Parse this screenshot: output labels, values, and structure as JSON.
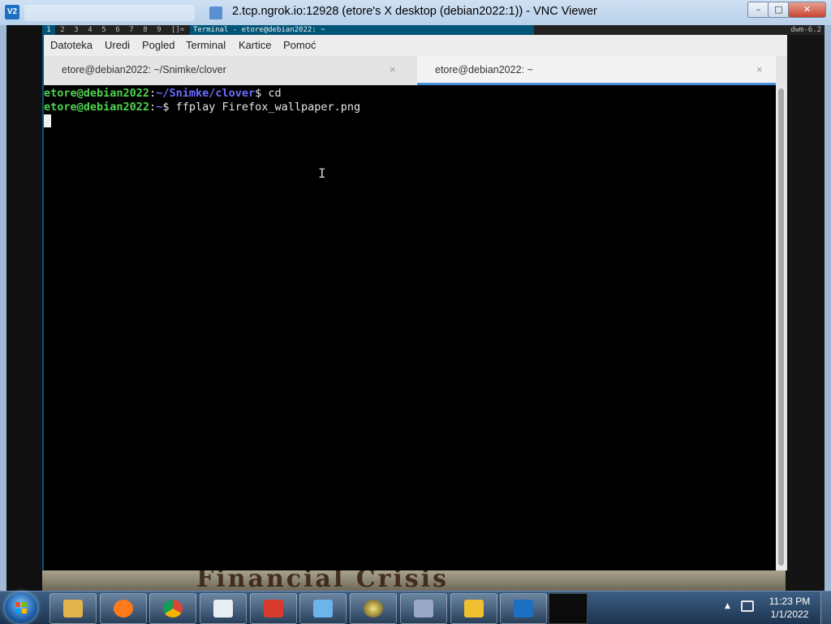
{
  "vnc_window": {
    "title": "2.tcp.ngrok.io:12928 (etore's X desktop (debian2022:1)) - VNC Viewer",
    "app_icon_text": "V2",
    "controls": {
      "minimize": "–",
      "maximize": "□",
      "close": "✕"
    }
  },
  "dwm": {
    "tags": [
      "1",
      "2",
      "3",
      "4",
      "5",
      "6",
      "7",
      "8",
      "9"
    ],
    "active_tag": "1",
    "layout_symbol": "[]=",
    "window_title": "Terminal - etore@debian2022: ~",
    "status": "dwm-6.2"
  },
  "terminal": {
    "menu": [
      "Datoteka",
      "Uredi",
      "Pogled",
      "Terminal",
      "Kartice",
      "Pomoć"
    ],
    "tabs": [
      {
        "label": "etore@debian2022: ~/Snimke/clover",
        "close": "×",
        "active": false
      },
      {
        "label": "etore@debian2022: ~",
        "close": "×",
        "active": true
      }
    ],
    "lines": [
      {
        "user": "etore@debian2022",
        "sep": ":",
        "path": "~/Snimke/clover",
        "prompt": "$ ",
        "command": "cd"
      },
      {
        "user": "etore@debian2022",
        "sep": ":",
        "path": "~",
        "prompt": "$ ",
        "command": "ffplay Firefox_wallpaper.png"
      }
    ]
  },
  "wallpaper_text": "Financial Crisis",
  "taskbar": {
    "apps": [
      {
        "name": "file-explorer",
        "color": "#e2b44a"
      },
      {
        "name": "firefox",
        "color": "#ff7a1a"
      },
      {
        "name": "chrome",
        "color": "#3fa34d"
      },
      {
        "name": "calculator-terminal",
        "color": "#e9eef5"
      },
      {
        "name": "toolbox",
        "color": "#d83a2c"
      },
      {
        "name": "control-panel",
        "color": "#6cb4ec"
      },
      {
        "name": "media-player",
        "color": "#c9a227"
      },
      {
        "name": "archive-manager",
        "color": "#9aa8c6"
      },
      {
        "name": "winamp",
        "color": "#f0c030"
      },
      {
        "name": "vnc-viewer",
        "color": "#1d6fc4"
      }
    ],
    "tray_arrow": "▲",
    "clock_time": "11:23 PM",
    "clock_date": "1/1/2022"
  }
}
